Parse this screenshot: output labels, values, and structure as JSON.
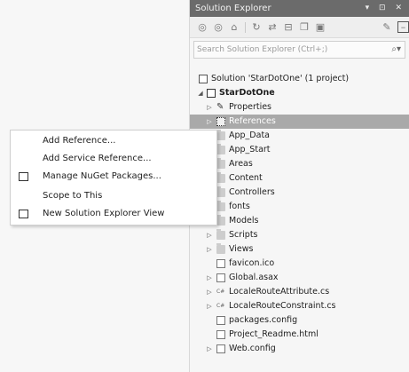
{
  "solution_explorer": {
    "title": "Solution Explorer",
    "title_buttons": [
      "▾",
      "⊡",
      "✕"
    ],
    "toolbar_icons": [
      "back-icon",
      "forward-icon",
      "home-icon",
      "refresh-icon",
      "sync-icon",
      "collapse-all-icon",
      "show-all-files-icon",
      "properties-wrench-icon",
      "pending-changes-icon"
    ],
    "search_placeholder": "Search Solution Explorer (Ctrl+;)",
    "tree": [
      {
        "label": "Solution 'StarDotOne' (1 project)",
        "kind": "solution"
      },
      {
        "label": "StarDotOne",
        "kind": "project"
      },
      {
        "label": "Properties",
        "kind": "properties"
      },
      {
        "label": "References",
        "kind": "references"
      },
      {
        "label": "App_Data",
        "kind": "folder"
      },
      {
        "label": "App_Start",
        "kind": "folder"
      },
      {
        "label": "Areas",
        "kind": "folder"
      },
      {
        "label": "Content",
        "kind": "folder"
      },
      {
        "label": "Controllers",
        "kind": "folder"
      },
      {
        "label": "fonts",
        "kind": "folder"
      },
      {
        "label": "Models",
        "kind": "folder"
      },
      {
        "label": "Scripts",
        "kind": "folder"
      },
      {
        "label": "Views",
        "kind": "folder"
      },
      {
        "label": "favicon.ico",
        "kind": "file"
      },
      {
        "label": "Global.asax",
        "kind": "file"
      },
      {
        "label": "LocaleRouteAttribute.cs",
        "kind": "cs"
      },
      {
        "label": "LocaleRouteConstraint.cs",
        "kind": "cs"
      },
      {
        "label": "packages.config",
        "kind": "config"
      },
      {
        "label": "Project_Readme.html",
        "kind": "html"
      },
      {
        "label": "Web.config",
        "kind": "config"
      }
    ]
  },
  "context_menu": {
    "items": [
      {
        "label": "Add Reference...",
        "icon": ""
      },
      {
        "label": "Add Service Reference...",
        "icon": ""
      },
      {
        "label": "Manage NuGet Packages...",
        "icon": "nuget-icon"
      },
      {
        "label": "Scope to This",
        "icon": ""
      },
      {
        "label": "New Solution Explorer View",
        "icon": "new-view-icon"
      }
    ]
  }
}
